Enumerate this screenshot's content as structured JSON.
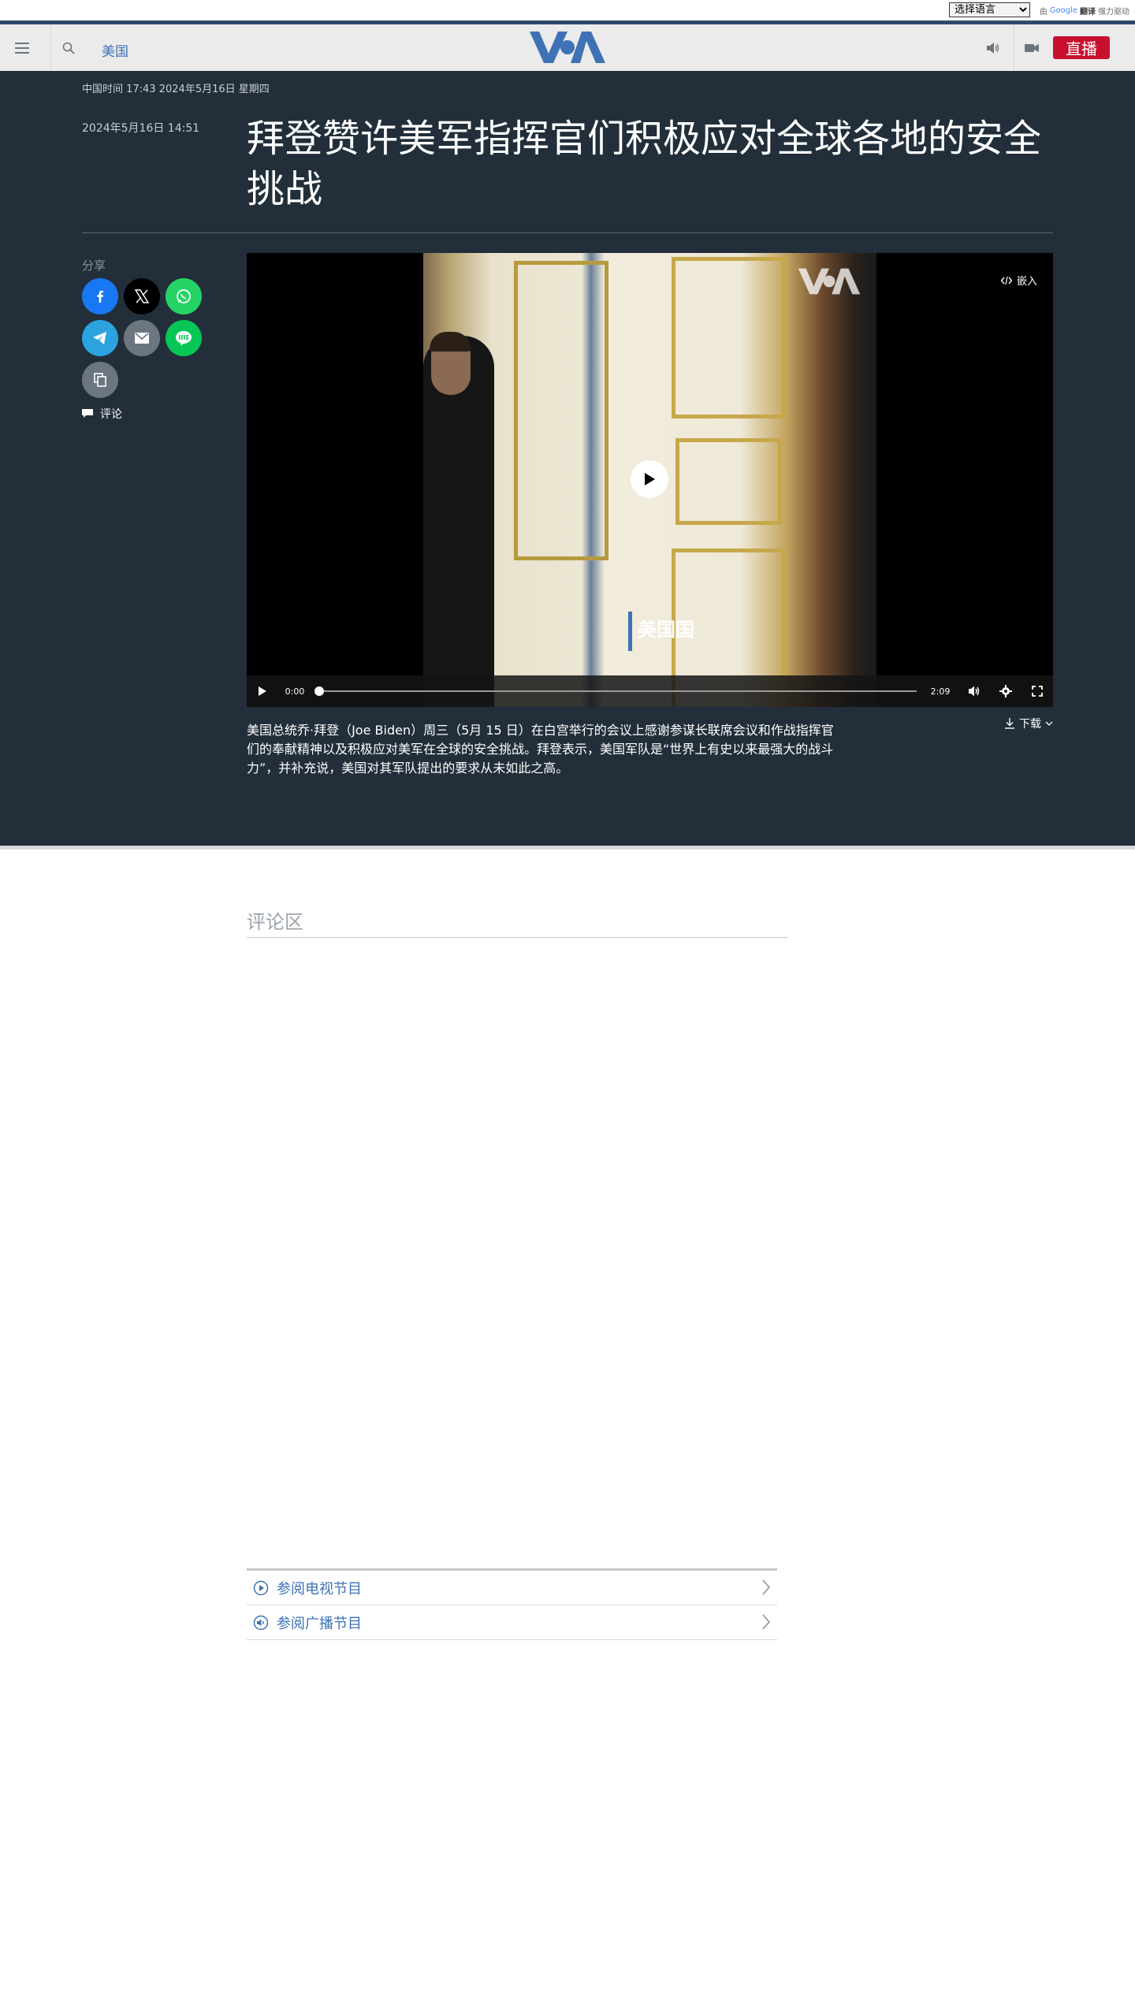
{
  "translate": {
    "select_label": "选择语言",
    "powered_prefix": "由",
    "google": "Google",
    "translate_word": "翻译",
    "powered_suffix": "强力驱动"
  },
  "nav": {
    "section": "美国",
    "live_label": "直播",
    "brand_color": "#3e72b5",
    "live_color": "#c8102e"
  },
  "article": {
    "time_bar": "中国时间 17:43 2024年5月16日 星期四",
    "publish_date": "2024年5月16日 14:51",
    "headline": "拜登赞许美军指挥官们积极应对全球各地的安全挑战",
    "share_label": "分享",
    "comment_label": "评论",
    "description": "美国总统乔·拜登（Joe Biden）周三（5月 15 日）在白宫举行的会议上感谢参谋长联席会议和作战指挥官们的奉献精神以及积极应对美军在全球的安全挑战。拜登表示，美国军队是“世界上有史以来最强大的战斗力”，并补充说，美国对其军队提出的要求从未如此之高。",
    "download_label": "下载"
  },
  "video": {
    "embed_label": "嵌入",
    "overlay_caption": "美国国",
    "current_time": "0:00",
    "duration": "2:09",
    "progress": 0
  },
  "share_buttons": [
    {
      "name": "facebook",
      "color": "#1877f2"
    },
    {
      "name": "x",
      "color": "#000000"
    },
    {
      "name": "whatsapp",
      "color": "#25d366"
    },
    {
      "name": "telegram",
      "color": "#2aa3df"
    },
    {
      "name": "email",
      "color": "#6b7680"
    },
    {
      "name": "line",
      "color": "#06c755"
    },
    {
      "name": "copy-link",
      "color": "#6b7680"
    }
  ],
  "comments": {
    "title": "评论区"
  },
  "programs": [
    {
      "label": "参阅电视节目",
      "icon": "play-circle-icon"
    },
    {
      "label": "参阅广播节目",
      "icon": "audio-circle-icon"
    }
  ]
}
